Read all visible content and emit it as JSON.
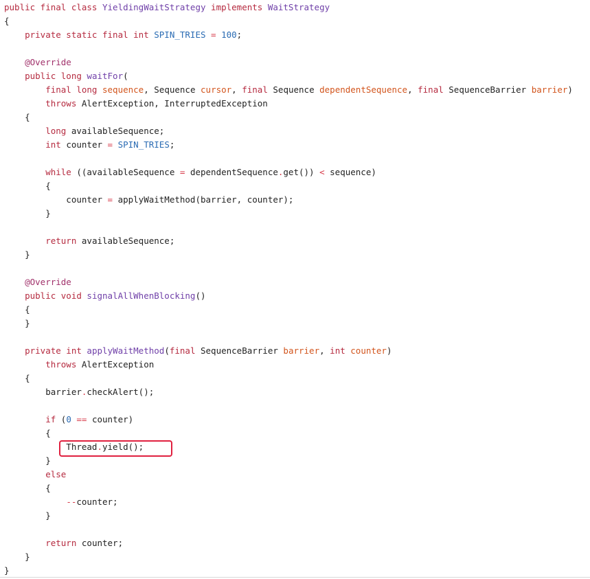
{
  "colors": {
    "keyword": "#b52a3f",
    "type": "#6f3fa8",
    "constant": "#2a6bb3",
    "param": "#d2541c",
    "operator": "#d73a49",
    "annotation": "#a0306a",
    "highlight": "#e0203f"
  },
  "highlighted_line": 32,
  "lines": [
    [
      [
        "public final class ",
        "k"
      ],
      [
        "YieldingWaitStrategy",
        "t"
      ],
      [
        " implements ",
        "k"
      ],
      [
        "WaitStrategy",
        "t"
      ]
    ],
    [
      [
        "{",
        "n"
      ]
    ],
    [
      [
        "    private static final int ",
        "k"
      ],
      [
        "SPIN_TRIES",
        "c"
      ],
      [
        " = ",
        "o"
      ],
      [
        "100",
        "c"
      ],
      [
        ";",
        "n"
      ]
    ],
    [],
    [
      [
        "    @Override",
        "a"
      ]
    ],
    [
      [
        "    public long ",
        "k"
      ],
      [
        "waitFor",
        "t"
      ],
      [
        "(",
        "n"
      ]
    ],
    [
      [
        "        final long ",
        "k"
      ],
      [
        "sequence",
        "p"
      ],
      [
        ", Sequence ",
        "n"
      ],
      [
        "cursor",
        "p"
      ],
      [
        ", ",
        "n"
      ],
      [
        "final ",
        "k"
      ],
      [
        "Sequence ",
        "n"
      ],
      [
        "dependentSequence",
        "p"
      ],
      [
        ", ",
        "n"
      ],
      [
        "final ",
        "k"
      ],
      [
        "SequenceBarrier ",
        "n"
      ],
      [
        "barrier",
        "p"
      ],
      [
        ")",
        "n"
      ]
    ],
    [
      [
        "        throws ",
        "k"
      ],
      [
        "AlertException, InterruptedException",
        "n"
      ]
    ],
    [
      [
        "    {",
        "n"
      ]
    ],
    [
      [
        "        long ",
        "k"
      ],
      [
        "availableSequence;",
        "n"
      ]
    ],
    [
      [
        "        int ",
        "k"
      ],
      [
        "counter ",
        "n"
      ],
      [
        "= ",
        "o"
      ],
      [
        "SPIN_TRIES",
        "c"
      ],
      [
        ";",
        "n"
      ]
    ],
    [],
    [
      [
        "        while ",
        "k"
      ],
      [
        "((availableSequence ",
        "n"
      ],
      [
        "= ",
        "o"
      ],
      [
        "dependentSequence",
        "n"
      ],
      [
        ".",
        "o"
      ],
      [
        "get()) ",
        "n"
      ],
      [
        "< ",
        "o"
      ],
      [
        "sequence)",
        "n"
      ]
    ],
    [
      [
        "        {",
        "n"
      ]
    ],
    [
      [
        "            counter ",
        "n"
      ],
      [
        "= ",
        "o"
      ],
      [
        "applyWaitMethod(barrier, counter);",
        "n"
      ]
    ],
    [
      [
        "        }",
        "n"
      ]
    ],
    [],
    [
      [
        "        return ",
        "k"
      ],
      [
        "availableSequence;",
        "n"
      ]
    ],
    [
      [
        "    }",
        "n"
      ]
    ],
    [],
    [
      [
        "    @Override",
        "a"
      ]
    ],
    [
      [
        "    public void ",
        "k"
      ],
      [
        "signalAllWhenBlocking",
        "t"
      ],
      [
        "()",
        "n"
      ]
    ],
    [
      [
        "    {",
        "n"
      ]
    ],
    [
      [
        "    }",
        "n"
      ]
    ],
    [],
    [
      [
        "    private int ",
        "k"
      ],
      [
        "applyWaitMethod",
        "t"
      ],
      [
        "(",
        "n"
      ],
      [
        "final ",
        "k"
      ],
      [
        "SequenceBarrier ",
        "n"
      ],
      [
        "barrier",
        "p"
      ],
      [
        ", ",
        "n"
      ],
      [
        "int ",
        "k"
      ],
      [
        "counter",
        "p"
      ],
      [
        ")",
        "n"
      ]
    ],
    [
      [
        "        throws ",
        "k"
      ],
      [
        "AlertException",
        "n"
      ]
    ],
    [
      [
        "    {",
        "n"
      ]
    ],
    [
      [
        "        barrier",
        "n"
      ],
      [
        ".",
        "o"
      ],
      [
        "checkAlert();",
        "n"
      ]
    ],
    [],
    [
      [
        "        if ",
        "k"
      ],
      [
        "(",
        "n"
      ],
      [
        "0",
        "c"
      ],
      [
        " == ",
        "o"
      ],
      [
        "counter)",
        "n"
      ]
    ],
    [
      [
        "        {",
        "n"
      ]
    ],
    [
      [
        "            Thread",
        "n"
      ],
      [
        ".",
        "o"
      ],
      [
        "yield();",
        "n"
      ]
    ],
    [
      [
        "        }",
        "n"
      ]
    ],
    [
      [
        "        else",
        "k"
      ]
    ],
    [
      [
        "        {",
        "n"
      ]
    ],
    [
      [
        "            ",
        "n"
      ],
      [
        "--",
        "o"
      ],
      [
        "counter;",
        "n"
      ]
    ],
    [
      [
        "        }",
        "n"
      ]
    ],
    [],
    [
      [
        "        return ",
        "k"
      ],
      [
        "counter;",
        "n"
      ]
    ],
    [
      [
        "    }",
        "n"
      ]
    ],
    [
      [
        "}",
        "n"
      ]
    ]
  ]
}
